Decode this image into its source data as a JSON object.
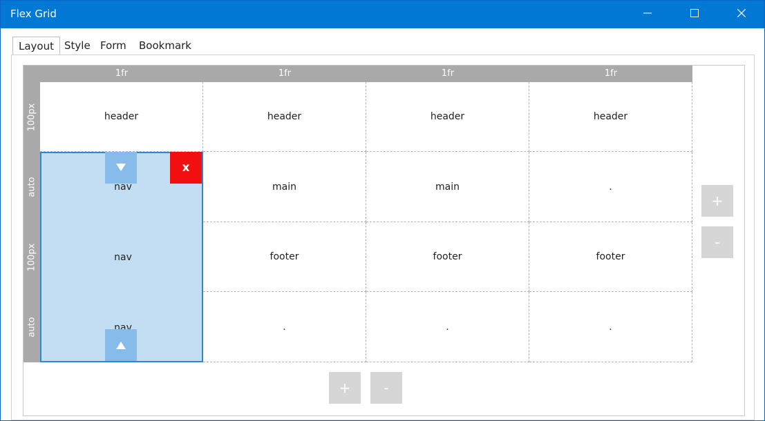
{
  "window": {
    "title": "Flex Grid",
    "accent": "#0078d4"
  },
  "tabs": [
    {
      "label": "Layout",
      "active": true
    },
    {
      "label": "Style",
      "active": false
    },
    {
      "label": "Form",
      "active": false
    },
    {
      "label": "Bookmark",
      "active": false
    }
  ],
  "grid": {
    "columns": [
      "1fr",
      "1fr",
      "1fr",
      "1fr"
    ],
    "rows": [
      "100px",
      "auto",
      "100px",
      "auto"
    ],
    "cells": [
      [
        "header",
        "header",
        "header",
        "header"
      ],
      [
        "nav",
        "main",
        "main",
        "."
      ],
      [
        "nav",
        "footer",
        "footer",
        "footer"
      ],
      [
        "nav",
        ".",
        ".",
        "."
      ]
    ],
    "selected_area": "nav",
    "selected_color": "#c3ddf3",
    "delete_label": "x"
  },
  "controls": {
    "add_row_label": "+",
    "remove_row_label": "-",
    "add_column_label": "+",
    "remove_column_label": "-"
  }
}
